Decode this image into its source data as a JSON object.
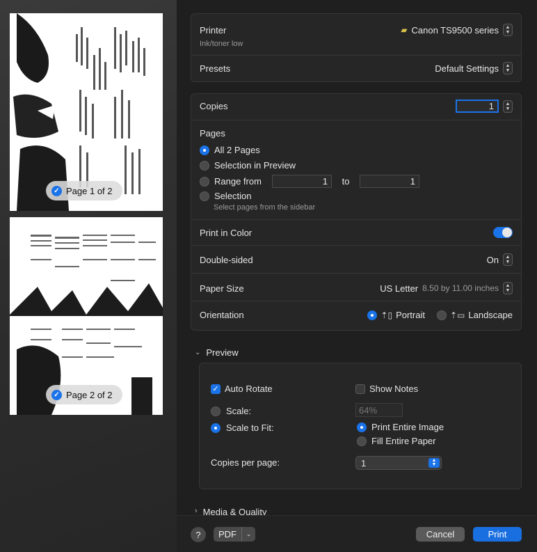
{
  "sidebar": {
    "pages": [
      {
        "chip_label": "Page 1 of 2"
      },
      {
        "chip_label": "Page 2 of 2"
      }
    ]
  },
  "printer": {
    "label": "Printer",
    "value": "Canon TS9500 series",
    "status": "Ink/toner low"
  },
  "presets": {
    "label": "Presets",
    "value": "Default Settings"
  },
  "copies": {
    "label": "Copies",
    "value": "1"
  },
  "pages": {
    "label": "Pages",
    "options": {
      "all": "All 2 Pages",
      "selection_preview": "Selection in Preview",
      "range_from": "Range from",
      "range_to": "to",
      "selection": "Selection",
      "selection_hint": "Select pages from the sidebar"
    },
    "range_start": "1",
    "range_end": "1"
  },
  "print_in_color": {
    "label": "Print in Color"
  },
  "double_sided": {
    "label": "Double-sided",
    "value": "On"
  },
  "paper_size": {
    "label": "Paper Size",
    "value": "US Letter",
    "dimensions": "8.50 by 11.00 inches"
  },
  "orientation": {
    "label": "Orientation",
    "portrait": "Portrait",
    "landscape": "Landscape"
  },
  "preview_section": {
    "title": "Preview",
    "auto_rotate": "Auto Rotate",
    "show_notes": "Show Notes",
    "scale": "Scale:",
    "scale_value": "64%",
    "scale_to_fit": "Scale to Fit:",
    "print_entire_image": "Print Entire Image",
    "fill_entire_paper": "Fill Entire Paper",
    "copies_per_page": "Copies per page:",
    "copies_per_page_value": "1"
  },
  "media_quality": {
    "title": "Media & Quality"
  },
  "footer": {
    "help": "?",
    "pdf": "PDF",
    "cancel": "Cancel",
    "print": "Print"
  },
  "colors": {
    "accent": "#1a73e8",
    "background": "#1f1f1f"
  }
}
